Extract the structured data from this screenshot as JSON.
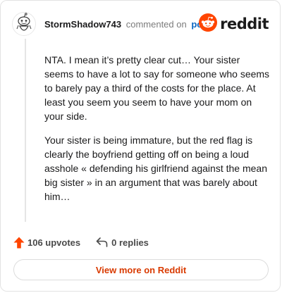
{
  "header": {
    "username": "StormShadow743",
    "verb": "commented on",
    "post_link": "post",
    "brand": "reddit"
  },
  "comment": {
    "paragraphs": [
      "NTA. I mean it’s pretty clear cut… Your sister seems to have a lot to say for someone who seems to barely pay a third of the costs for the place. At least you seem you seem to have your mom on your side.",
      "Your sister is being immature, but the red flag is clearly the boyfriend getting off on being a loud asshole « defending his girlfriend against the mean big sister » in an argument that was barely about him…"
    ]
  },
  "footer": {
    "upvotes": "106 upvotes",
    "replies": "0 replies",
    "view_more": "View more on Reddit"
  },
  "colors": {
    "reddit_orange": "#ff4500",
    "upvote_arrow": "#ff4500",
    "link_blue": "#0a66c2",
    "button_text": "#d93a00"
  },
  "icons": {
    "avatar": "snoo-avatar-icon",
    "brand": "reddit-logo-icon",
    "upvote": "upvote-arrow-icon",
    "reply": "reply-arrow-icon"
  }
}
